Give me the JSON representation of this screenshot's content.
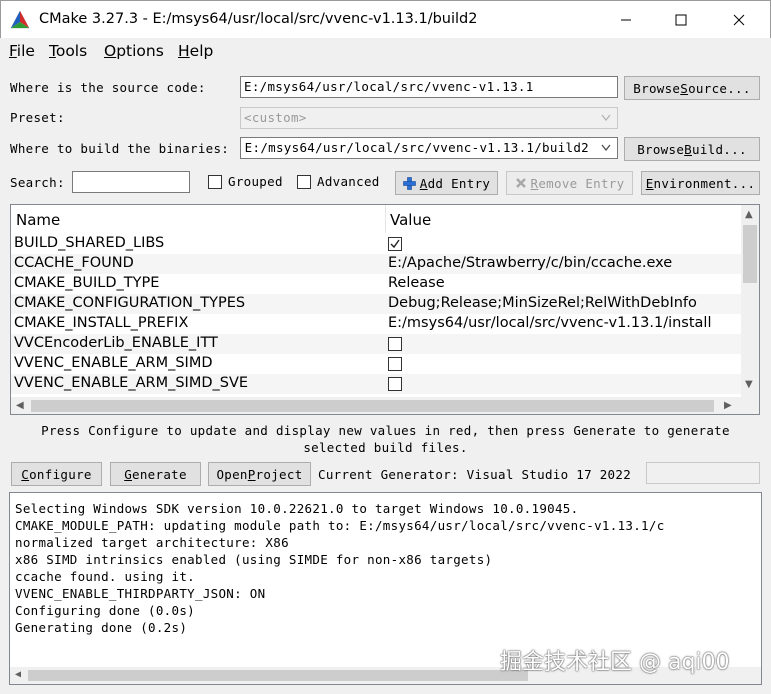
{
  "window": {
    "title": "CMake 3.27.3 - E:/msys64/usr/local/src/vvenc-v1.13.1/build2"
  },
  "menu": {
    "file": "File",
    "tools": "Tools",
    "options": "Options",
    "help": "Help"
  },
  "source": {
    "label": "Where is the source code:",
    "value": "E:/msys64/usr/local/src/vvenc-v1.13.1",
    "browse_pre": "Browse ",
    "browse_u": "S",
    "browse_post": "ource..."
  },
  "preset": {
    "label": "Preset:",
    "value": "<custom>"
  },
  "build": {
    "label": "Where to build the binaries:",
    "value": "E:/msys64/usr/local/src/vvenc-v1.13.1/build2",
    "browse_pre": "Browse ",
    "browse_u": "B",
    "browse_post": "uild..."
  },
  "search": {
    "label": "Search:",
    "value": "",
    "grouped": "Grouped",
    "advanced": "Advanced",
    "add_u": "A",
    "add_post": "dd Entry",
    "remove_u": "R",
    "remove_post": "emove Entry",
    "env_u": "E",
    "env_post": "nvironment..."
  },
  "table": {
    "col_name": "Name",
    "col_value": "Value",
    "rows": [
      {
        "name": "BUILD_SHARED_LIBS",
        "value": "",
        "checked": true,
        "type": "bool"
      },
      {
        "name": "CCACHE_FOUND",
        "value": "E:/Apache/Strawberry/c/bin/ccache.exe",
        "type": "text"
      },
      {
        "name": "CMAKE_BUILD_TYPE",
        "value": "Release",
        "type": "text"
      },
      {
        "name": "CMAKE_CONFIGURATION_TYPES",
        "value": "Debug;Release;MinSizeRel;RelWithDebInfo",
        "type": "text"
      },
      {
        "name": "CMAKE_INSTALL_PREFIX",
        "value": "E:/msys64/usr/local/src/vvenc-v1.13.1/install",
        "type": "text"
      },
      {
        "name": "VVCEncoderLib_ENABLE_ITT",
        "value": "",
        "checked": false,
        "type": "bool"
      },
      {
        "name": "VVENC_ENABLE_ARM_SIMD",
        "value": "",
        "checked": false,
        "type": "bool"
      },
      {
        "name": "VVENC_ENABLE_ARM_SIMD_SVE",
        "value": "",
        "checked": false,
        "type": "bool"
      }
    ]
  },
  "hint": {
    "line1": "Press Configure to update and display new values in red, then press Generate to generate",
    "line2": "selected build files."
  },
  "actions": {
    "configure_u": "C",
    "configure_post": "onfigure",
    "generate_u": "G",
    "generate_post": "enerate",
    "open_pre": "Open ",
    "open_u": "P",
    "open_post": "roject",
    "generator": "Current Generator: Visual Studio 17 2022"
  },
  "log": {
    "lines": [
      "Selecting Windows SDK version 10.0.22621.0 to target Windows 10.0.19045.",
      "CMAKE_MODULE_PATH: updating module path to: E:/msys64/usr/local/src/vvenc-v1.13.1/c",
      "normalized target architecture: X86",
      "x86 SIMD intrinsics enabled (using SIMDE for non-x86 targets)",
      "ccache found. using it.",
      "VVENC_ENABLE_THIRDPARTY_JSON: ON",
      "Configuring done (0.0s)",
      "Generating done (0.2s)"
    ]
  },
  "watermark": "掘金技术社区 @ aqi00"
}
